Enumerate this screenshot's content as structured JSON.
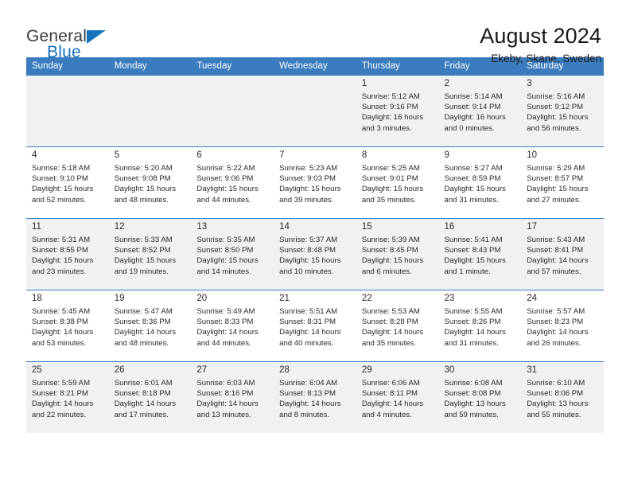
{
  "brand": {
    "word1": "General",
    "word2": "Blue",
    "triangle_color": "#1673bd"
  },
  "header": {
    "title": "August 2024",
    "location": "Ekeby, Skane, Sweden"
  },
  "theme": {
    "header_row_bg": "#3a7cbe",
    "header_row_text": "#ffffff",
    "shaded_cell_bg": "#f1f1f1",
    "plain_cell_bg": "#ffffff",
    "cell_border": "#3a7cbe"
  },
  "weekday_headers": [
    "Sunday",
    "Monday",
    "Tuesday",
    "Wednesday",
    "Thursday",
    "Friday",
    "Saturday"
  ],
  "weeks": [
    [
      {
        "day": "",
        "sunrise": "",
        "sunset": "",
        "daylight_1": "",
        "daylight_2": ""
      },
      {
        "day": "",
        "sunrise": "",
        "sunset": "",
        "daylight_1": "",
        "daylight_2": ""
      },
      {
        "day": "",
        "sunrise": "",
        "sunset": "",
        "daylight_1": "",
        "daylight_2": ""
      },
      {
        "day": "",
        "sunrise": "",
        "sunset": "",
        "daylight_1": "",
        "daylight_2": ""
      },
      {
        "day": "1",
        "sunrise": "Sunrise: 5:12 AM",
        "sunset": "Sunset: 9:16 PM",
        "daylight_1": "Daylight: 16 hours",
        "daylight_2": "and 3 minutes."
      },
      {
        "day": "2",
        "sunrise": "Sunrise: 5:14 AM",
        "sunset": "Sunset: 9:14 PM",
        "daylight_1": "Daylight: 16 hours",
        "daylight_2": "and 0 minutes."
      },
      {
        "day": "3",
        "sunrise": "Sunrise: 5:16 AM",
        "sunset": "Sunset: 9:12 PM",
        "daylight_1": "Daylight: 15 hours",
        "daylight_2": "and 56 minutes."
      }
    ],
    [
      {
        "day": "4",
        "sunrise": "Sunrise: 5:18 AM",
        "sunset": "Sunset: 9:10 PM",
        "daylight_1": "Daylight: 15 hours",
        "daylight_2": "and 52 minutes."
      },
      {
        "day": "5",
        "sunrise": "Sunrise: 5:20 AM",
        "sunset": "Sunset: 9:08 PM",
        "daylight_1": "Daylight: 15 hours",
        "daylight_2": "and 48 minutes."
      },
      {
        "day": "6",
        "sunrise": "Sunrise: 5:22 AM",
        "sunset": "Sunset: 9:06 PM",
        "daylight_1": "Daylight: 15 hours",
        "daylight_2": "and 44 minutes."
      },
      {
        "day": "7",
        "sunrise": "Sunrise: 5:23 AM",
        "sunset": "Sunset: 9:03 PM",
        "daylight_1": "Daylight: 15 hours",
        "daylight_2": "and 39 minutes."
      },
      {
        "day": "8",
        "sunrise": "Sunrise: 5:25 AM",
        "sunset": "Sunset: 9:01 PM",
        "daylight_1": "Daylight: 15 hours",
        "daylight_2": "and 35 minutes."
      },
      {
        "day": "9",
        "sunrise": "Sunrise: 5:27 AM",
        "sunset": "Sunset: 8:59 PM",
        "daylight_1": "Daylight: 15 hours",
        "daylight_2": "and 31 minutes."
      },
      {
        "day": "10",
        "sunrise": "Sunrise: 5:29 AM",
        "sunset": "Sunset: 8:57 PM",
        "daylight_1": "Daylight: 15 hours",
        "daylight_2": "and 27 minutes."
      }
    ],
    [
      {
        "day": "11",
        "sunrise": "Sunrise: 5:31 AM",
        "sunset": "Sunset: 8:55 PM",
        "daylight_1": "Daylight: 15 hours",
        "daylight_2": "and 23 minutes."
      },
      {
        "day": "12",
        "sunrise": "Sunrise: 5:33 AM",
        "sunset": "Sunset: 8:52 PM",
        "daylight_1": "Daylight: 15 hours",
        "daylight_2": "and 19 minutes."
      },
      {
        "day": "13",
        "sunrise": "Sunrise: 5:35 AM",
        "sunset": "Sunset: 8:50 PM",
        "daylight_1": "Daylight: 15 hours",
        "daylight_2": "and 14 minutes."
      },
      {
        "day": "14",
        "sunrise": "Sunrise: 5:37 AM",
        "sunset": "Sunset: 8:48 PM",
        "daylight_1": "Daylight: 15 hours",
        "daylight_2": "and 10 minutes."
      },
      {
        "day": "15",
        "sunrise": "Sunrise: 5:39 AM",
        "sunset": "Sunset: 8:45 PM",
        "daylight_1": "Daylight: 15 hours",
        "daylight_2": "and 6 minutes."
      },
      {
        "day": "16",
        "sunrise": "Sunrise: 5:41 AM",
        "sunset": "Sunset: 8:43 PM",
        "daylight_1": "Daylight: 15 hours",
        "daylight_2": "and 1 minute."
      },
      {
        "day": "17",
        "sunrise": "Sunrise: 5:43 AM",
        "sunset": "Sunset: 8:41 PM",
        "daylight_1": "Daylight: 14 hours",
        "daylight_2": "and 57 minutes."
      }
    ],
    [
      {
        "day": "18",
        "sunrise": "Sunrise: 5:45 AM",
        "sunset": "Sunset: 8:38 PM",
        "daylight_1": "Daylight: 14 hours",
        "daylight_2": "and 53 minutes."
      },
      {
        "day": "19",
        "sunrise": "Sunrise: 5:47 AM",
        "sunset": "Sunset: 8:36 PM",
        "daylight_1": "Daylight: 14 hours",
        "daylight_2": "and 48 minutes."
      },
      {
        "day": "20",
        "sunrise": "Sunrise: 5:49 AM",
        "sunset": "Sunset: 8:33 PM",
        "daylight_1": "Daylight: 14 hours",
        "daylight_2": "and 44 minutes."
      },
      {
        "day": "21",
        "sunrise": "Sunrise: 5:51 AM",
        "sunset": "Sunset: 8:31 PM",
        "daylight_1": "Daylight: 14 hours",
        "daylight_2": "and 40 minutes."
      },
      {
        "day": "22",
        "sunrise": "Sunrise: 5:53 AM",
        "sunset": "Sunset: 8:28 PM",
        "daylight_1": "Daylight: 14 hours",
        "daylight_2": "and 35 minutes."
      },
      {
        "day": "23",
        "sunrise": "Sunrise: 5:55 AM",
        "sunset": "Sunset: 8:26 PM",
        "daylight_1": "Daylight: 14 hours",
        "daylight_2": "and 31 minutes."
      },
      {
        "day": "24",
        "sunrise": "Sunrise: 5:57 AM",
        "sunset": "Sunset: 8:23 PM",
        "daylight_1": "Daylight: 14 hours",
        "daylight_2": "and 26 minutes."
      }
    ],
    [
      {
        "day": "25",
        "sunrise": "Sunrise: 5:59 AM",
        "sunset": "Sunset: 8:21 PM",
        "daylight_1": "Daylight: 14 hours",
        "daylight_2": "and 22 minutes."
      },
      {
        "day": "26",
        "sunrise": "Sunrise: 6:01 AM",
        "sunset": "Sunset: 8:18 PM",
        "daylight_1": "Daylight: 14 hours",
        "daylight_2": "and 17 minutes."
      },
      {
        "day": "27",
        "sunrise": "Sunrise: 6:03 AM",
        "sunset": "Sunset: 8:16 PM",
        "daylight_1": "Daylight: 14 hours",
        "daylight_2": "and 13 minutes."
      },
      {
        "day": "28",
        "sunrise": "Sunrise: 6:04 AM",
        "sunset": "Sunset: 8:13 PM",
        "daylight_1": "Daylight: 14 hours",
        "daylight_2": "and 8 minutes."
      },
      {
        "day": "29",
        "sunrise": "Sunrise: 6:06 AM",
        "sunset": "Sunset: 8:11 PM",
        "daylight_1": "Daylight: 14 hours",
        "daylight_2": "and 4 minutes."
      },
      {
        "day": "30",
        "sunrise": "Sunrise: 6:08 AM",
        "sunset": "Sunset: 8:08 PM",
        "daylight_1": "Daylight: 13 hours",
        "daylight_2": "and 59 minutes."
      },
      {
        "day": "31",
        "sunrise": "Sunrise: 6:10 AM",
        "sunset": "Sunset: 8:06 PM",
        "daylight_1": "Daylight: 13 hours",
        "daylight_2": "and 55 minutes."
      }
    ]
  ]
}
